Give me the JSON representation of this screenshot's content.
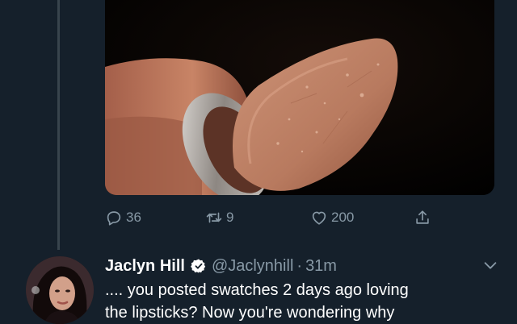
{
  "tweet_actions": {
    "replies": "36",
    "retweets": "9",
    "likes": "200"
  },
  "reply_tweet": {
    "author_name": "Jaclyn Hill",
    "handle": "@Jaclynhill",
    "separator": "·",
    "time": "31m",
    "text_line1": ".... you posted swatches 2 days ago loving",
    "text_line2": "the lipsticks? Now you're wondering why"
  },
  "icons": {
    "reply": "comment-icon",
    "retweet": "retweet-icon",
    "like": "heart-icon",
    "share": "share-icon",
    "verified": "verified-badge-icon",
    "more": "chevron-down-icon"
  },
  "colors": {
    "background": "#15202b",
    "muted_text": "#8899a6",
    "verified_badge": "#ffffff",
    "thread_line": "#38444d"
  }
}
